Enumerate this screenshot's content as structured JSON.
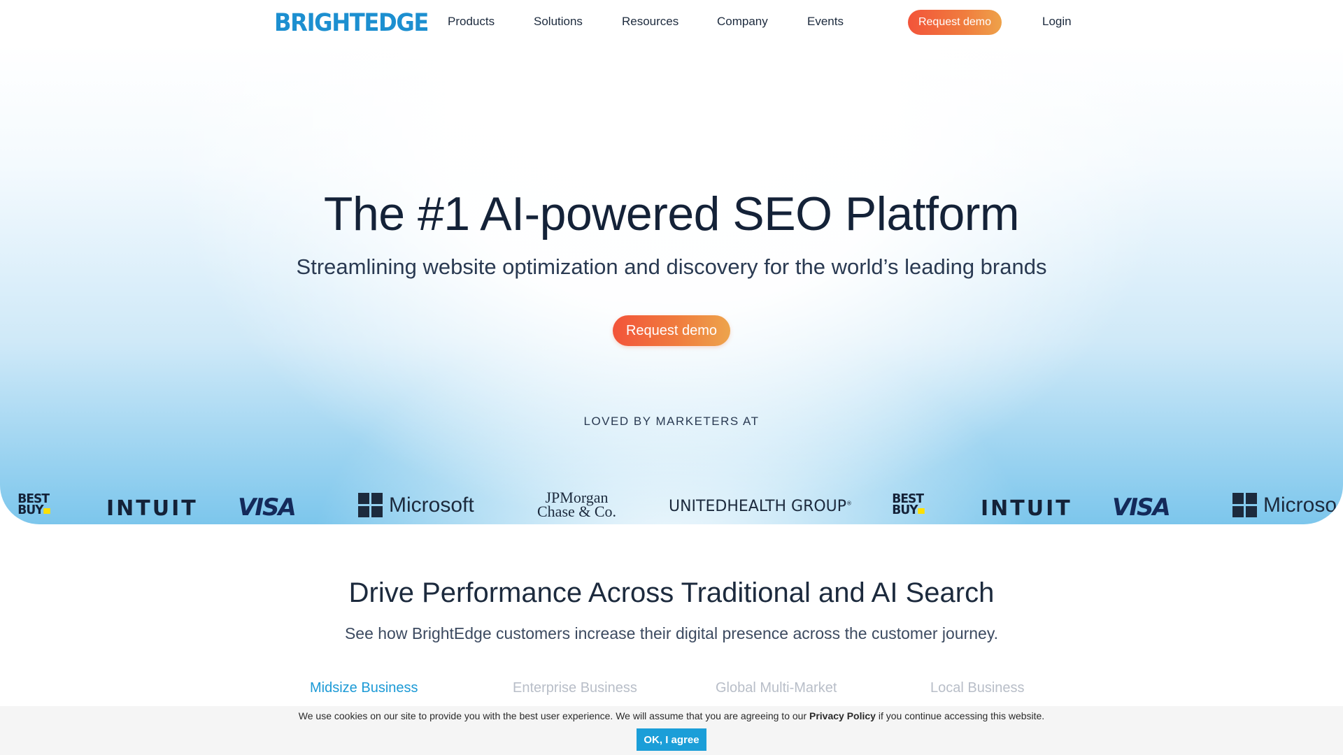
{
  "header": {
    "logo": "BRIGHTEDGE",
    "nav": [
      "Products",
      "Solutions",
      "Resources",
      "Company",
      "Events"
    ],
    "cta": "Request demo",
    "login": "Login"
  },
  "hero": {
    "title": "The #1 AI-powered SEO Platform",
    "subtitle": "Streamlining website optimization and discovery for the world’s leading brands",
    "cta": "Request demo",
    "loved_label": "LOVED BY MARKETERS AT",
    "logos": {
      "bestbuy_line1": "BEST",
      "bestbuy_line2": "BUY",
      "intuit": "INTUIT",
      "visa": "VISA",
      "microsoft": "Microsoft",
      "microsoft_cut": "Microso",
      "jpm_line1": "JPMorgan",
      "jpm_line2": "Chase & Co.",
      "uhg": "UNITEDHEALTH GROUP",
      "uhg_mark": "®"
    }
  },
  "section": {
    "title": "Drive Performance Across Traditional and AI Search",
    "subtitle": "See how BrightEdge customers increase their digital presence across the customer journey.",
    "tabs": [
      "Midsize Business",
      "Enterprise Business",
      "Global Multi-Market",
      "Local Business"
    ],
    "active_tab": "Midsize Business"
  },
  "cookie": {
    "text_before": "We use cookies on our site to provide you with the best user experience. We will assume that you are agreeing to our ",
    "link": "Privacy Policy",
    "text_after": " if you continue accessing this website.",
    "button": "OK, I agree"
  },
  "colors": {
    "brand": "#1c8fd0",
    "cta_start": "#f2543a",
    "cta_end": "#eea24a",
    "active_tab": "#1c9ad6",
    "cookie_button": "#1b9ed8"
  }
}
